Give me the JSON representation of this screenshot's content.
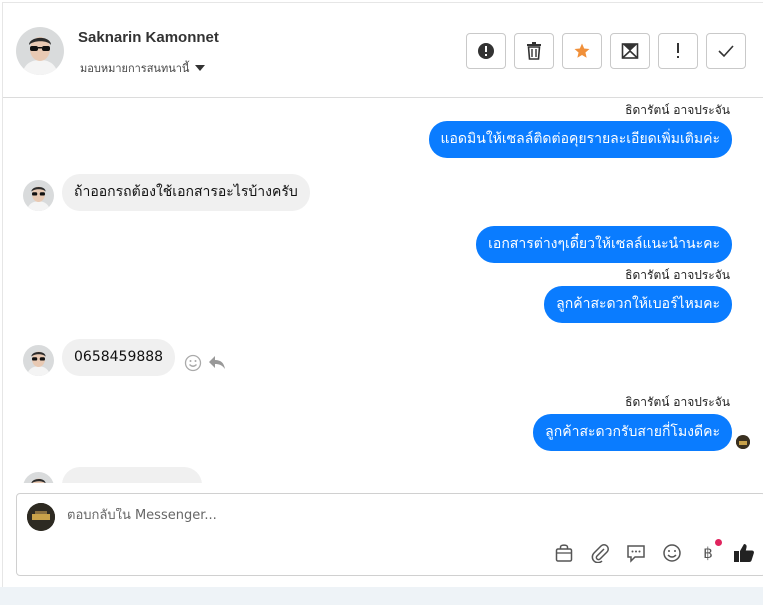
{
  "header": {
    "contact_name": "Saknarin Kamonnet",
    "assignment_label": "มอบหมายการสนทนานี้",
    "actions": [
      {
        "name": "mark-spam-button",
        "icon": "alert-circle-icon"
      },
      {
        "name": "delete-button",
        "icon": "trash-icon"
      },
      {
        "name": "follow-up-button",
        "icon": "star-icon",
        "color": "#f0903a"
      },
      {
        "name": "mark-unread-button",
        "icon": "envelope-icon"
      },
      {
        "name": "priority-button",
        "icon": "exclamation-icon"
      },
      {
        "name": "mark-done-button",
        "icon": "check-icon"
      }
    ]
  },
  "messages": [
    {
      "direction": "out",
      "sender": "ธิดารัตน์ อาจประจัน",
      "text": "แอดมินให้เซลล์ติดต่อคุยรายละเอียดเพิ่มเติมค่ะ"
    },
    {
      "direction": "in",
      "text": "ถ้าออกรถต้องใช้เอกสารอะไรบ้างครับ"
    },
    {
      "direction": "out",
      "text": "เอกสารต่างๆเดี๋ยวให้เซลล์แนะนำนะคะ"
    },
    {
      "direction": "out",
      "sender": "ธิดารัตน์ อาจประจัน",
      "text": "ลูกค้าสะดวกให้เบอร์ไหมคะ"
    },
    {
      "direction": "in",
      "text": "0658459888"
    },
    {
      "direction": "out",
      "sender": "ธิดารัตน์ อาจประจัน",
      "text": "ลูกค้าสะดวกรับสายกี่โมงดีคะ"
    }
  ],
  "composer": {
    "placeholder": "ตอบกลับใน Messenger...",
    "tools": [
      "bag-icon",
      "paperclip-icon",
      "chat-bubbles-icon",
      "smiley-icon",
      "baht-icon",
      "thumbs-up-icon"
    ],
    "baht_symbol": "฿"
  },
  "colors": {
    "accent": "#0a7cff",
    "incoming_bubble": "#f0f0f0",
    "notification_dot": "#e0245e"
  }
}
